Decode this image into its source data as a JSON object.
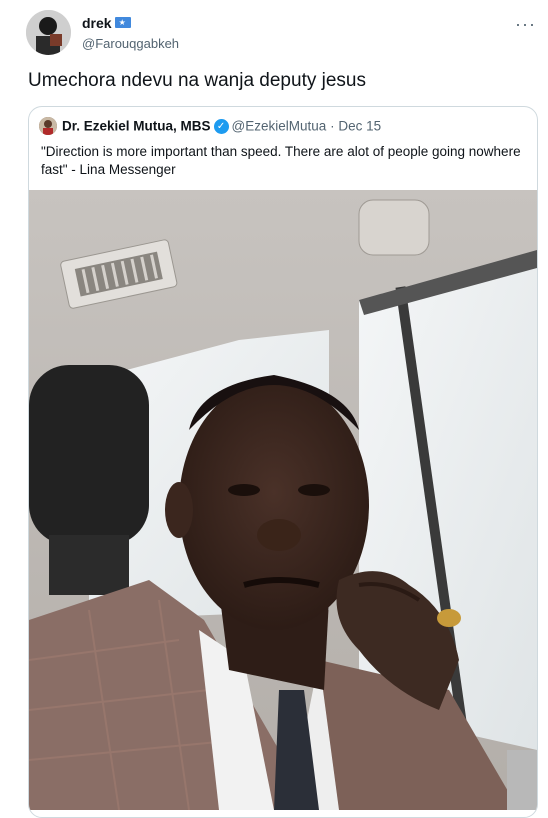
{
  "tweet": {
    "display_name": "drek",
    "flag_icon": "somalia-flag-icon",
    "handle": "@Farouqgabkeh",
    "text": "Umechora ndevu na wanja deputy jesus",
    "more_icon": "···"
  },
  "quote": {
    "display_name": "Dr. Ezekiel Mutua, MBS",
    "verified_icon": "✓",
    "handle": "@EzekielMutua",
    "separator": "·",
    "date": "Dec 15",
    "text": "\"Direction is more important than speed. There are alot of people going nowhere fast\" - Lina Messenger"
  },
  "colors": {
    "text_primary": "#0f1419",
    "text_secondary": "#536471",
    "border": "#cfd9de",
    "verified": "#1d9bf0"
  }
}
